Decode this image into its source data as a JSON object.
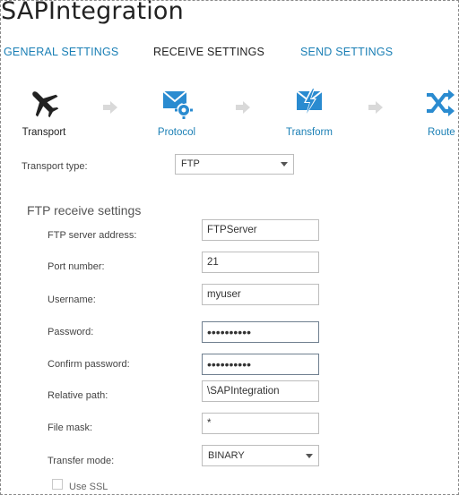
{
  "app": {
    "title": "SAPIntegration"
  },
  "tabs": [
    {
      "label": "GENERAL SETTINGS",
      "active": false
    },
    {
      "label": "RECEIVE SETTINGS",
      "active": true
    },
    {
      "label": "SEND SETTINGS",
      "active": false
    }
  ],
  "steps": [
    {
      "label": "Transport",
      "icon": "airplane-icon"
    },
    {
      "label": "Protocol",
      "icon": "envelope-gear-icon"
    },
    {
      "label": "Transform",
      "icon": "envelope-lightning-icon"
    },
    {
      "label": "Route",
      "icon": "shuffle-icon"
    }
  ],
  "transport": {
    "label": "Transport type:",
    "value": "FTP"
  },
  "ftp": {
    "section_title": "FTP receive settings",
    "server": {
      "label": "FTP server address:",
      "value": "FTPServer"
    },
    "port": {
      "label": "Port number:",
      "value": "21"
    },
    "username": {
      "label": "Username:",
      "value": "myuser"
    },
    "password": {
      "label": "Password:",
      "value": "••••••••••"
    },
    "confirm": {
      "label": "Confirm password:",
      "value": "••••••••••"
    },
    "path": {
      "label": "Relative path:",
      "value": "\\SAPIntegration"
    },
    "mask": {
      "label": "File mask:",
      "value": "*"
    },
    "mode": {
      "label": "Transfer mode:",
      "value": "BINARY"
    },
    "ssl": {
      "label": "Use SSL",
      "checked": false
    }
  },
  "colors": {
    "accent": "#1a7fb5",
    "icon_blue": "#2a8bd0",
    "text_dark": "#222222",
    "arrow_gray": "#d9d9d9"
  }
}
